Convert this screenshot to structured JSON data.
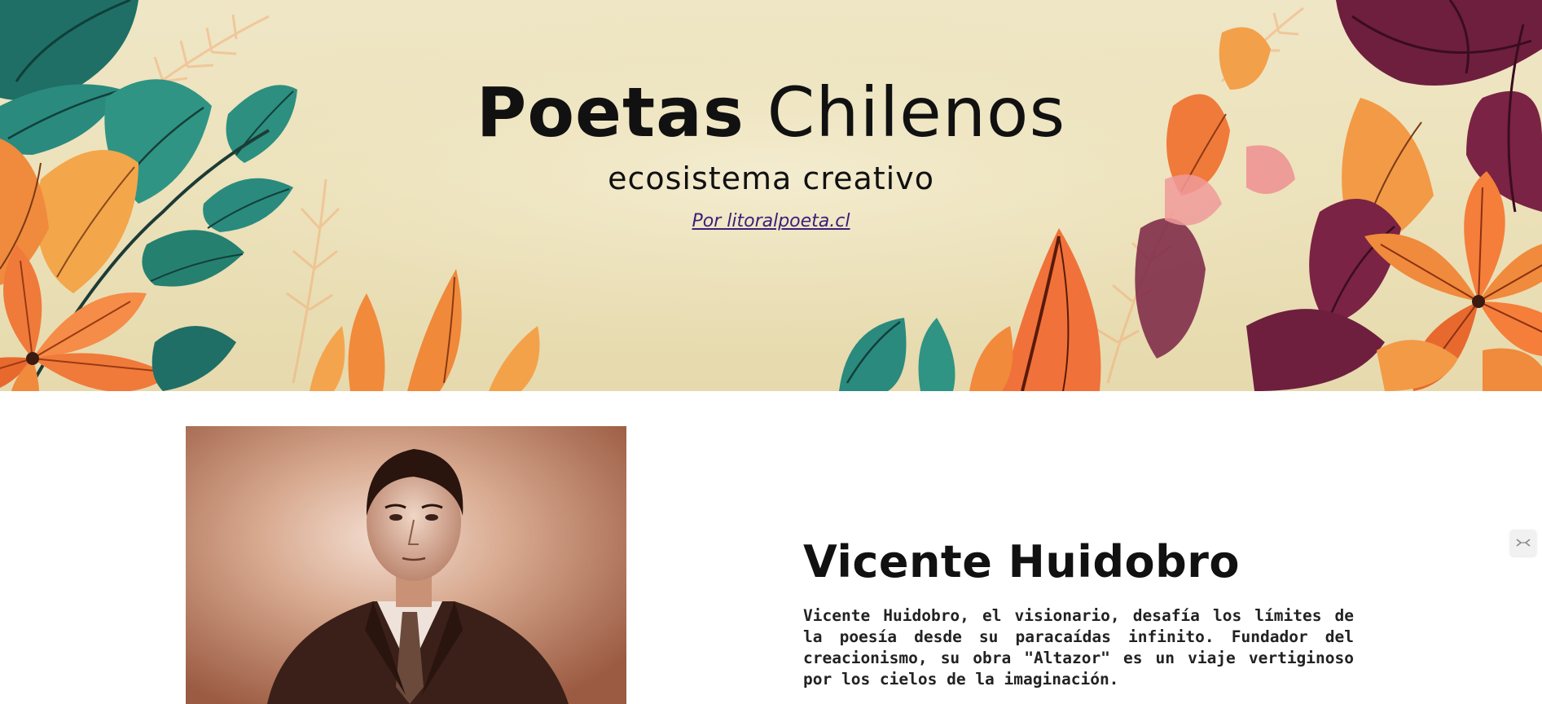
{
  "hero": {
    "title_strong": "Poetas",
    "title_rest": " Chilenos",
    "subtitle": "ecosistema creativo",
    "credit_link": "Por litoralpoeta.cl"
  },
  "poet": {
    "name": "Vicente Huidobro",
    "bio": "Vicente Huidobro, el visionario, desafía los límites de la poesía desde su paracaídas infinito. Fundador del creacionismo, su obra \"Altazor\" es un viaje vertiginoso por los cielos de la imaginación.",
    "portrait_icon": "portrait-photo"
  },
  "side_widget": {
    "icon": "collapse-arrows-icon"
  },
  "colors": {
    "hero_background": "#ece2bb",
    "teal_leaf": "#2a8a7e",
    "orange_leaf": "#f07a3a",
    "maroon_leaf": "#7a2344",
    "link": "#3a1f7a"
  }
}
